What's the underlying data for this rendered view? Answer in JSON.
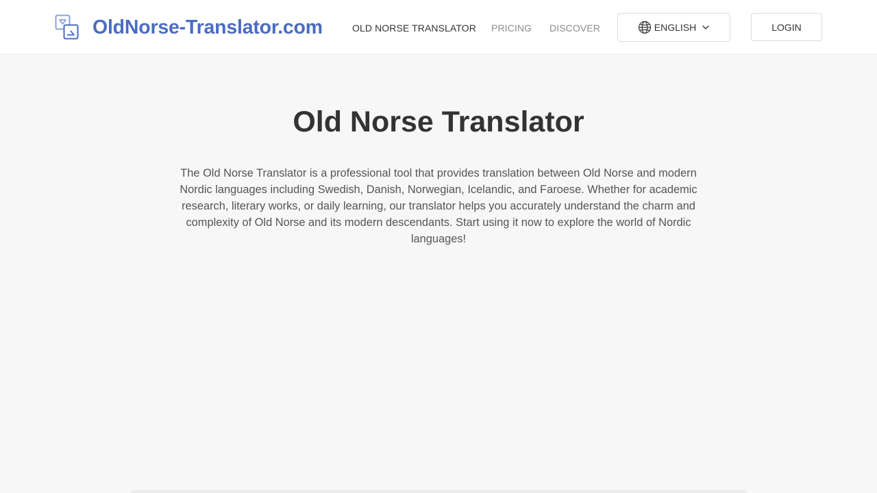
{
  "header": {
    "logo": {
      "icon": "translate-icon",
      "text": "OldNorse-Translator.com",
      "color": "#4b6cc1"
    },
    "nav": [
      {
        "label": "OLD NORSE TRANSLATOR",
        "active": true
      },
      {
        "label": "PRICING",
        "active": false
      },
      {
        "label": "DISCOVER",
        "active": false
      }
    ],
    "language": {
      "icon": "globe-icon",
      "label": "ENGLISH",
      "dropdown_icon": "chevron-down-icon"
    },
    "login_label": "LOGIN"
  },
  "hero": {
    "title": "Old Norse Translator",
    "description": "The Old Norse Translator is a professional tool that provides translation between Old Norse and modern Nordic languages including Swedish, Danish, Norwegian, Icelandic, and Faroese. Whether for academic research, literary works, or daily learning, our translator helps you accurately understand the charm and complexity of Old Norse and its modern descendants. Start using it now to explore the world of Nordic languages!"
  },
  "colors": {
    "brand": "#4b6cc1",
    "page_background": "#f7f7f7",
    "header_background": "#ffffff",
    "text_primary": "#333333",
    "text_muted": "#8c8c8c"
  }
}
